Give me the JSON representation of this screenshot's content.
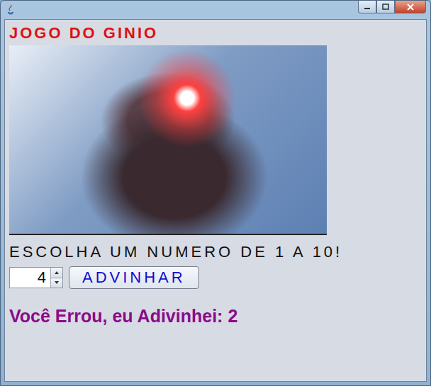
{
  "heading": "JOGO DO GINIO",
  "prompt": "ESCOLHA UM NUMERO DE 1 A 10!",
  "spinner": {
    "value": "4"
  },
  "guess_button": "ADVINHAR",
  "result": "Você Errou, eu Adivinhei: 2"
}
